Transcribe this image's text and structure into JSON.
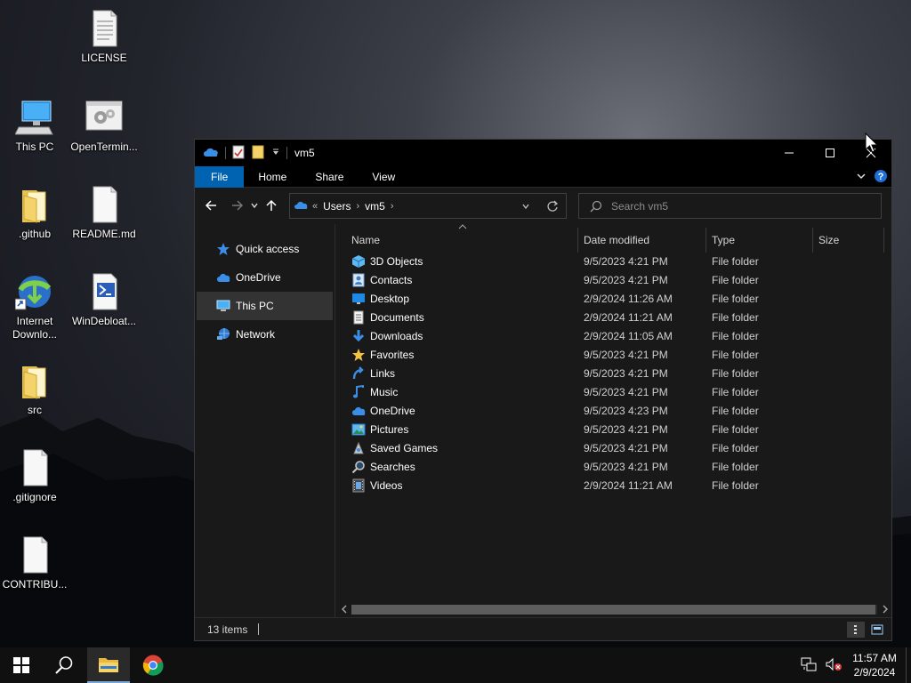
{
  "desktop": {
    "icons": [
      {
        "label": "LICENSE",
        "icon": "text-file-icon"
      },
      {
        "label": "This PC",
        "icon": "computer-icon"
      },
      {
        "label": "OpenTermin...",
        "icon": "settings-gears-icon"
      },
      {
        "label": ".github",
        "icon": "folder-icon"
      },
      {
        "label": "README.md",
        "icon": "blank-file-icon"
      },
      {
        "label": "Internet Downlo...",
        "icon": "internet-download-manager-icon"
      },
      {
        "label": "WinDebloat...",
        "icon": "powershell-script-icon"
      },
      {
        "label": "src",
        "icon": "folder-icon"
      },
      {
        "label": ".gitignore",
        "icon": "blank-file-icon"
      },
      {
        "label": "CONTRIBU...",
        "icon": "blank-file-icon"
      }
    ]
  },
  "window": {
    "title": "vm5",
    "ribbon_tabs": [
      "File",
      "Home",
      "Share",
      "View"
    ],
    "address": {
      "prefix": "«",
      "crumbs": [
        "Users",
        "vm5"
      ]
    },
    "search": {
      "placeholder": "Search vm5"
    },
    "nav_pane": [
      {
        "label": "Quick access",
        "icon": "star-icon"
      },
      {
        "label": "OneDrive",
        "icon": "cloud-icon"
      },
      {
        "label": "This PC",
        "icon": "computer-icon",
        "selected": true
      },
      {
        "label": "Network",
        "icon": "network-icon"
      }
    ],
    "columns": [
      "Name",
      "Date modified",
      "Type",
      "Size"
    ],
    "rows": [
      {
        "name": "3D Objects",
        "date": "9/5/2023 4:21 PM",
        "type": "File folder",
        "icon": "cube-icon"
      },
      {
        "name": "Contacts",
        "date": "9/5/2023 4:21 PM",
        "type": "File folder",
        "icon": "contacts-icon"
      },
      {
        "name": "Desktop",
        "date": "2/9/2024 11:26 AM",
        "type": "File folder",
        "icon": "desktop-icon"
      },
      {
        "name": "Documents",
        "date": "2/9/2024 11:21 AM",
        "type": "File folder",
        "icon": "document-icon"
      },
      {
        "name": "Downloads",
        "date": "2/9/2024 11:05 AM",
        "type": "File folder",
        "icon": "download-arrow-icon"
      },
      {
        "name": "Favorites",
        "date": "9/5/2023 4:21 PM",
        "type": "File folder",
        "icon": "star-icon"
      },
      {
        "name": "Links",
        "date": "9/5/2023 4:21 PM",
        "type": "File folder",
        "icon": "link-arrow-icon"
      },
      {
        "name": "Music",
        "date": "9/5/2023 4:21 PM",
        "type": "File folder",
        "icon": "music-note-icon"
      },
      {
        "name": "OneDrive",
        "date": "9/5/2023 4:23 PM",
        "type": "File folder",
        "icon": "cloud-icon"
      },
      {
        "name": "Pictures",
        "date": "9/5/2023 4:21 PM",
        "type": "File folder",
        "icon": "picture-icon"
      },
      {
        "name": "Saved Games",
        "date": "9/5/2023 4:21 PM",
        "type": "File folder",
        "icon": "game-icon"
      },
      {
        "name": "Searches",
        "date": "9/5/2023 4:21 PM",
        "type": "File folder",
        "icon": "magnifier-icon"
      },
      {
        "name": "Videos",
        "date": "2/9/2024 11:21 AM",
        "type": "File folder",
        "icon": "film-icon"
      }
    ],
    "status": {
      "item_count": "13 items"
    }
  },
  "taskbar": {
    "clock": {
      "time": "11:57 AM",
      "date": "2/9/2024"
    }
  },
  "colors": {
    "file_tab": "#0063b1",
    "window_bg": "#191919",
    "titlebar_bg": "#000000",
    "folder_yellow": "#f4d36b",
    "onedrive_blue": "#3a8ee6"
  }
}
